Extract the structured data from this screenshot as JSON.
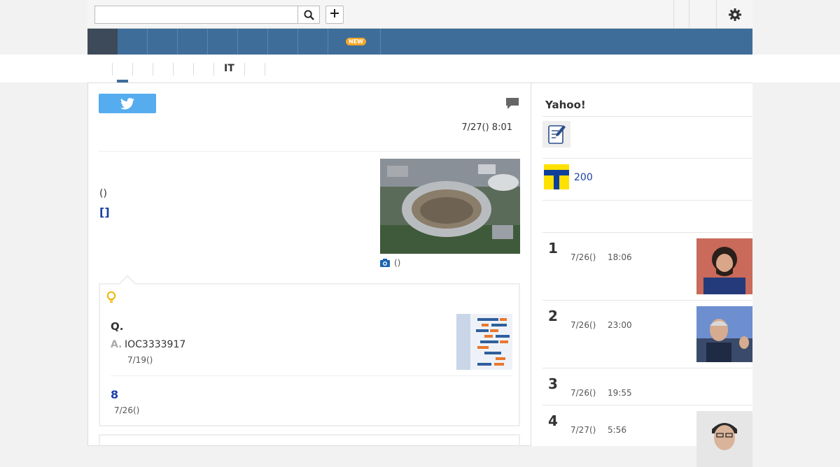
{
  "search": {
    "value": "",
    "placeholder": ""
  },
  "subnav": {
    "items": [
      "",
      "",
      "",
      "",
      "",
      "IT",
      "",
      ""
    ]
  },
  "nav": {
    "new_badge": "NEW"
  },
  "article": {
    "date": "7/27() 8:01",
    "paren": "()",
    "bracket_link": "[]",
    "photo_caption": "()"
  },
  "qa": {
    "q_label": "Q.",
    "a_label": "A.",
    "a_text": "IOC3333917",
    "a_date": "7/19()",
    "count": "8",
    "count_date": "7/26()"
  },
  "sidebar": {
    "title": "Yahoo!",
    "tpoint": "200",
    "ranking": [
      {
        "rank": "1",
        "date": "7/26()",
        "time": "18:06"
      },
      {
        "rank": "2",
        "date": "7/26()",
        "time": "23:00"
      },
      {
        "rank": "3",
        "date": "7/26()",
        "time": "19:55"
      },
      {
        "rank": "4",
        "date": "7/27()",
        "time": "5:56"
      }
    ]
  },
  "colors": {
    "nav_blue": "#3e6d9a",
    "link_blue": "#1a3fa8",
    "twitter": "#55acee",
    "tpoint_yellow": "#ffe100"
  }
}
